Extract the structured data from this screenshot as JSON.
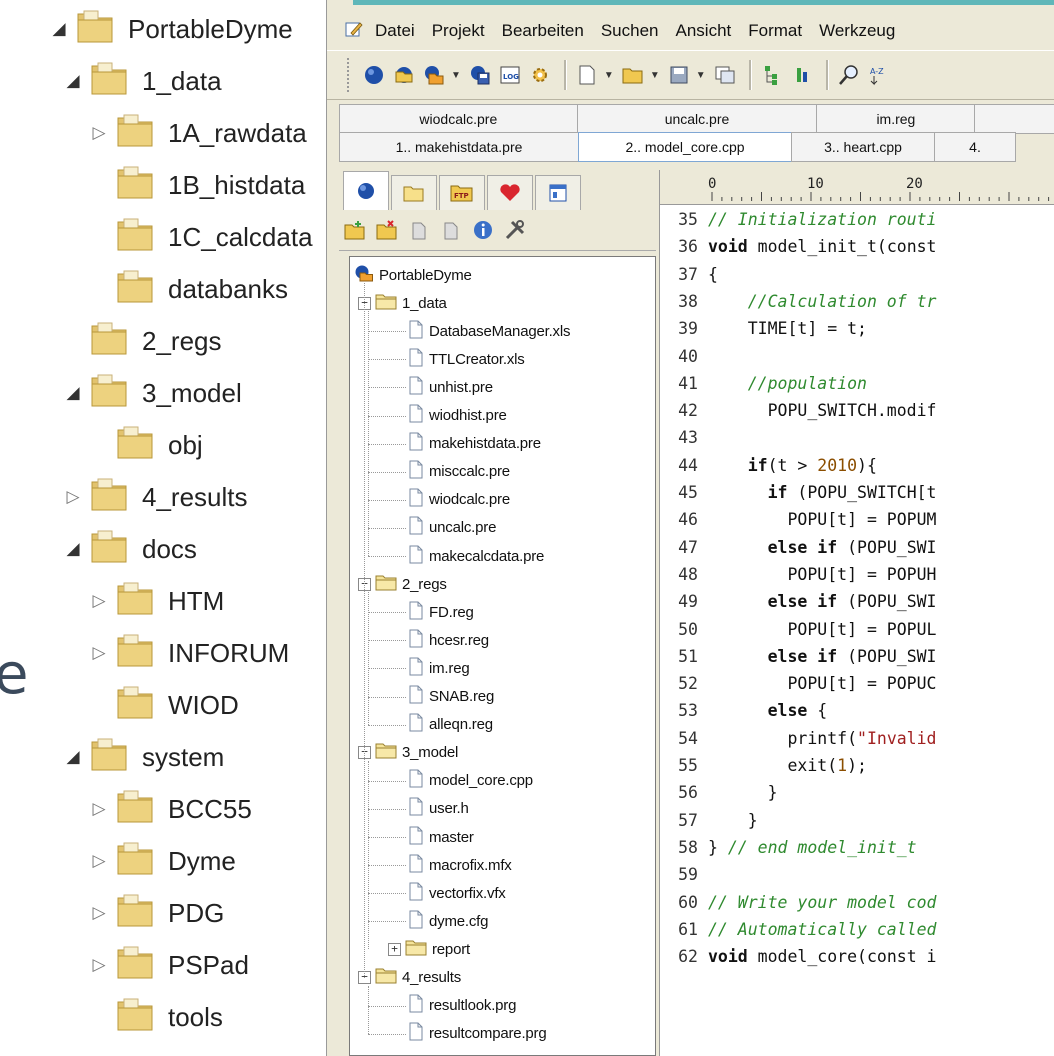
{
  "left_tree": [
    {
      "label": "PortableDyme",
      "level": 0,
      "arrow": "open"
    },
    {
      "label": "1_data",
      "level": 1,
      "arrow": "open"
    },
    {
      "label": "1A_rawdata",
      "level": 2,
      "arrow": "closed"
    },
    {
      "label": "1B_histdata",
      "level": 2,
      "arrow": "none"
    },
    {
      "label": "1C_calcdata",
      "level": 2,
      "arrow": "none"
    },
    {
      "label": "databanks",
      "level": 2,
      "arrow": "none"
    },
    {
      "label": "2_regs",
      "level": 1,
      "arrow": "none"
    },
    {
      "label": "3_model",
      "level": 1,
      "arrow": "open"
    },
    {
      "label": "obj",
      "level": 2,
      "arrow": "none"
    },
    {
      "label": "4_results",
      "level": 1,
      "arrow": "closed"
    },
    {
      "label": "docs",
      "level": 1,
      "arrow": "open"
    },
    {
      "label": "HTM",
      "level": 2,
      "arrow": "closed"
    },
    {
      "label": "INFORUM",
      "level": 2,
      "arrow": "closed"
    },
    {
      "label": "WIOD",
      "level": 2,
      "arrow": "none"
    },
    {
      "label": "system",
      "level": 1,
      "arrow": "open"
    },
    {
      "label": "BCC55",
      "level": 2,
      "arrow": "closed"
    },
    {
      "label": "Dyme",
      "level": 2,
      "arrow": "closed"
    },
    {
      "label": "PDG",
      "level": 2,
      "arrow": "closed"
    },
    {
      "label": "PSPad",
      "level": 2,
      "arrow": "closed"
    },
    {
      "label": "tools",
      "level": 2,
      "arrow": "none"
    }
  ],
  "cut_text": "e",
  "menu": [
    "Datei",
    "Projekt",
    "Bearbeiten",
    "Suchen",
    "Ansicht",
    "Format",
    "Werkzeug"
  ],
  "tabs_row1": [
    {
      "label": "wiodcalc.pre",
      "active": false
    },
    {
      "label": "uncalc.pre",
      "active": false
    },
    {
      "label": "im.reg",
      "active": false
    },
    {
      "label": "",
      "active": false
    }
  ],
  "tabs_row2": [
    {
      "label": "1.. makehistdata.pre",
      "active": false
    },
    {
      "label": "2.. model_core.cpp",
      "active": true
    },
    {
      "label": "3.. heart.cpp",
      "active": false
    },
    {
      "label": "4.",
      "active": false
    }
  ],
  "ruler_marks": [
    "0",
    "10",
    "20"
  ],
  "project_tree": [
    {
      "label": "PortableDyme",
      "level": 0,
      "type": "project"
    },
    {
      "label": "1_data",
      "level": 1,
      "type": "folder",
      "expander": "-"
    },
    {
      "label": "DatabaseManager.xls",
      "level": 2,
      "type": "file"
    },
    {
      "label": "TTLCreator.xls",
      "level": 2,
      "type": "file"
    },
    {
      "label": "unhist.pre",
      "level": 2,
      "type": "file"
    },
    {
      "label": "wiodhist.pre",
      "level": 2,
      "type": "file"
    },
    {
      "label": "makehistdata.pre",
      "level": 2,
      "type": "file"
    },
    {
      "label": "misccalc.pre",
      "level": 2,
      "type": "file"
    },
    {
      "label": "wiodcalc.pre",
      "level": 2,
      "type": "file"
    },
    {
      "label": "uncalc.pre",
      "level": 2,
      "type": "file"
    },
    {
      "label": "makecalcdata.pre",
      "level": 2,
      "type": "file"
    },
    {
      "label": "2_regs",
      "level": 1,
      "type": "folder",
      "expander": "-"
    },
    {
      "label": "FD.reg",
      "level": 2,
      "type": "file"
    },
    {
      "label": "hcesr.reg",
      "level": 2,
      "type": "file"
    },
    {
      "label": "im.reg",
      "level": 2,
      "type": "file"
    },
    {
      "label": "SNAB.reg",
      "level": 2,
      "type": "file"
    },
    {
      "label": "alleqn.reg",
      "level": 2,
      "type": "file"
    },
    {
      "label": "3_model",
      "level": 1,
      "type": "folder",
      "expander": "-"
    },
    {
      "label": "model_core.cpp",
      "level": 2,
      "type": "file"
    },
    {
      "label": "user.h",
      "level": 2,
      "type": "file"
    },
    {
      "label": "master",
      "level": 2,
      "type": "file"
    },
    {
      "label": "macrofix.mfx",
      "level": 2,
      "type": "file"
    },
    {
      "label": "vectorfix.vfx",
      "level": 2,
      "type": "file"
    },
    {
      "label": "dyme.cfg",
      "level": 2,
      "type": "file"
    },
    {
      "label": "report",
      "level": 2,
      "type": "folder",
      "expander": "+"
    },
    {
      "label": "4_results",
      "level": 1,
      "type": "folder",
      "expander": "-"
    },
    {
      "label": "resultlook.prg",
      "level": 2,
      "type": "file"
    },
    {
      "label": "resultcompare.prg",
      "level": 2,
      "type": "file"
    }
  ],
  "code_lines": [
    {
      "n": "35",
      "tokens": [
        {
          "t": "// Initialization routi",
          "c": "comment"
        }
      ]
    },
    {
      "n": "36",
      "tokens": [
        {
          "t": "void",
          "c": "kw"
        },
        {
          "t": " model_init_t(const",
          "c": "plain"
        }
      ]
    },
    {
      "n": "37",
      "tokens": [
        {
          "t": "{",
          "c": "plain"
        }
      ]
    },
    {
      "n": "38",
      "tokens": [
        {
          "t": "    //Calculation of tr",
          "c": "comment"
        }
      ]
    },
    {
      "n": "39",
      "tokens": [
        {
          "t": "    TIME[t] = t;",
          "c": "plain"
        }
      ]
    },
    {
      "n": "40",
      "tokens": []
    },
    {
      "n": "41",
      "tokens": [
        {
          "t": "    //population",
          "c": "comment"
        }
      ]
    },
    {
      "n": "42",
      "tokens": [
        {
          "t": "      POPU_SWITCH.modif",
          "c": "plain"
        }
      ]
    },
    {
      "n": "43",
      "tokens": []
    },
    {
      "n": "44",
      "tokens": [
        {
          "t": "    ",
          "c": "plain"
        },
        {
          "t": "if",
          "c": "kw"
        },
        {
          "t": "(t > ",
          "c": "plain"
        },
        {
          "t": "2010",
          "c": "num"
        },
        {
          "t": "){",
          "c": "plain"
        }
      ]
    },
    {
      "n": "45",
      "tokens": [
        {
          "t": "      ",
          "c": "plain"
        },
        {
          "t": "if",
          "c": "kw"
        },
        {
          "t": " (POPU_SWITCH[t",
          "c": "plain"
        }
      ]
    },
    {
      "n": "46",
      "tokens": [
        {
          "t": "        POPU[t] = POPUM",
          "c": "plain"
        }
      ]
    },
    {
      "n": "47",
      "tokens": [
        {
          "t": "      ",
          "c": "plain"
        },
        {
          "t": "else if",
          "c": "kw"
        },
        {
          "t": " (POPU_SWI",
          "c": "plain"
        }
      ]
    },
    {
      "n": "48",
      "tokens": [
        {
          "t": "        POPU[t] = POPUH",
          "c": "plain"
        }
      ]
    },
    {
      "n": "49",
      "tokens": [
        {
          "t": "      ",
          "c": "plain"
        },
        {
          "t": "else if",
          "c": "kw"
        },
        {
          "t": " (POPU_SWI",
          "c": "plain"
        }
      ]
    },
    {
      "n": "50",
      "tokens": [
        {
          "t": "        POPU[t] = POPUL",
          "c": "plain"
        }
      ]
    },
    {
      "n": "51",
      "tokens": [
        {
          "t": "      ",
          "c": "plain"
        },
        {
          "t": "else if",
          "c": "kw"
        },
        {
          "t": " (POPU_SWI",
          "c": "plain"
        }
      ]
    },
    {
      "n": "52",
      "tokens": [
        {
          "t": "        POPU[t] = POPUC",
          "c": "plain"
        }
      ]
    },
    {
      "n": "53",
      "tokens": [
        {
          "t": "      ",
          "c": "plain"
        },
        {
          "t": "else",
          "c": "kw"
        },
        {
          "t": " {",
          "c": "plain"
        }
      ]
    },
    {
      "n": "54",
      "tokens": [
        {
          "t": "        printf(",
          "c": "plain"
        },
        {
          "t": "\"Invalid",
          "c": "str"
        }
      ]
    },
    {
      "n": "55",
      "tokens": [
        {
          "t": "        exit(",
          "c": "plain"
        },
        {
          "t": "1",
          "c": "num"
        },
        {
          "t": ");",
          "c": "plain"
        }
      ]
    },
    {
      "n": "56",
      "tokens": [
        {
          "t": "      }",
          "c": "plain"
        }
      ]
    },
    {
      "n": "57",
      "tokens": [
        {
          "t": "    }",
          "c": "plain"
        }
      ]
    },
    {
      "n": "58",
      "tokens": [
        {
          "t": "} ",
          "c": "plain"
        },
        {
          "t": "// end model_init_t",
          "c": "comment"
        }
      ]
    },
    {
      "n": "59",
      "tokens": []
    },
    {
      "n": "60",
      "tokens": [
        {
          "t": "// Write your model cod",
          "c": "comment"
        }
      ]
    },
    {
      "n": "61",
      "tokens": [
        {
          "t": "// Automatically called",
          "c": "comment"
        }
      ]
    },
    {
      "n": "62",
      "tokens": [
        {
          "t": "void",
          "c": "kw"
        },
        {
          "t": " model_core(const i",
          "c": "plain"
        }
      ]
    }
  ],
  "colors": {
    "accent": "#5fb7b9",
    "comment": "#2f8a2f",
    "folder": "#e0c26b",
    "heart": "#d9262e"
  }
}
